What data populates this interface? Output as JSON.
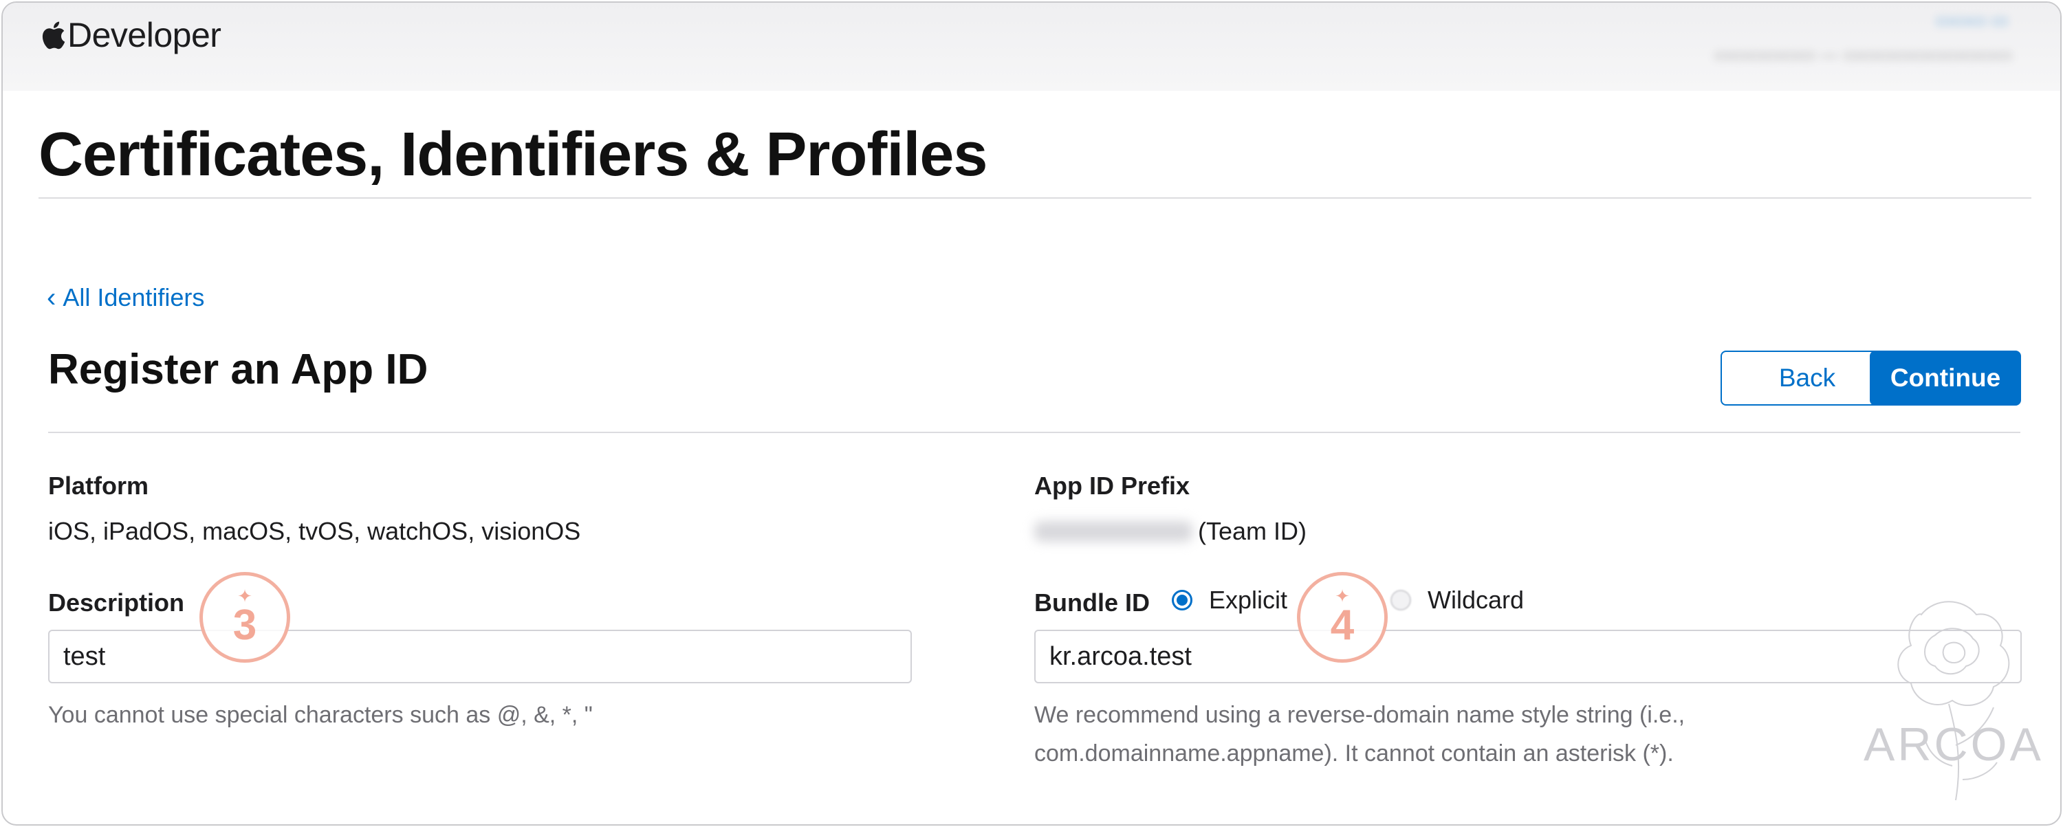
{
  "header": {
    "brand_name": "Developer",
    "logo_icon": "apple-logo-icon"
  },
  "page": {
    "title": "Certificates, Identifiers & Profiles"
  },
  "nav": {
    "back_chevron": "‹",
    "back_link": "All Identifiers"
  },
  "form": {
    "title": "Register an App ID",
    "buttons": {
      "back": "Back",
      "continue": "Continue"
    },
    "platform": {
      "label": "Platform",
      "value": "iOS, iPadOS, macOS, tvOS, watchOS, visionOS"
    },
    "app_id_prefix": {
      "label": "App ID Prefix",
      "suffix": "(Team ID)"
    },
    "description": {
      "label": "Description",
      "value": "test",
      "help": "You cannot use special characters such as @, &, *, \""
    },
    "bundle_id": {
      "label": "Bundle ID",
      "options": [
        "Explicit",
        "Wildcard"
      ],
      "selected": "Explicit",
      "value": "kr.arcoa.test",
      "help_line1": "We recommend using a reverse-domain name style string (i.e.,",
      "help_line2": "com.domainname.appname). It cannot contain an asterisk (*)."
    }
  },
  "annotations": {
    "marker_a": "3",
    "marker_b": "4",
    "marker_color": "#f3a896"
  },
  "watermark": {
    "text": "ARCOA"
  },
  "colors": {
    "accent": "#0070c9",
    "text": "#1d1d1f",
    "muted": "#6e6e73"
  }
}
